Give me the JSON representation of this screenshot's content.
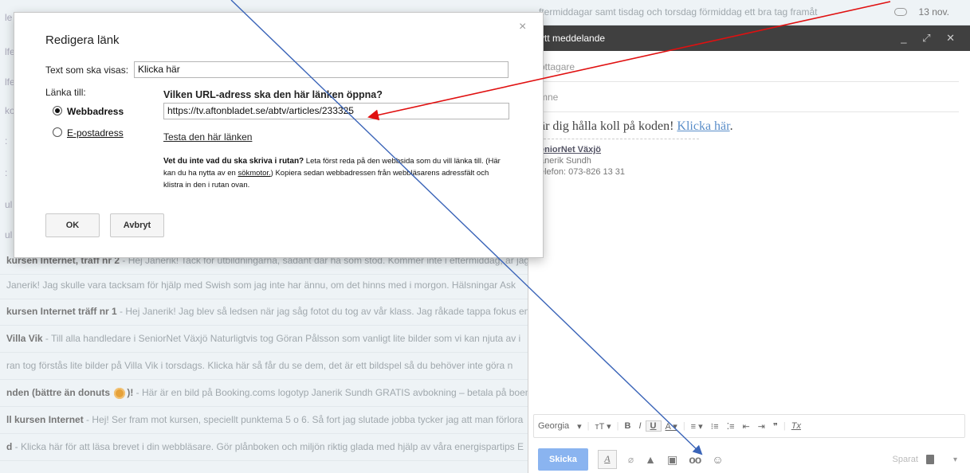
{
  "inbox": {
    "sidebar_fragments": [
      "le",
      "lfe",
      "lfe",
      "ko",
      ":",
      ":",
      "ul",
      "ul",
      ":"
    ],
    "rows": [
      {
        "sender": "kursen Internet, träff nr 2",
        "snippet": " - Hej Janerik! Tack för utbildningarna, sådant där ha som stöd. Kommer inte i eftermiddag, är jag"
      },
      {
        "sender": "",
        "snippet": "Janerik! Jag skulle vara tacksam för hjälp med Swish som jag inte har ännu, om det hinns med i morgon. Hälsningar Ask"
      },
      {
        "sender": "kursen Internet träff nr 1",
        "snippet": " - Hej Janerik! Jag blev så ledsen när jag såg fotot du tog av vår klass. Jag råkade tappa fokus en"
      },
      {
        "sender": "Villa Vik",
        "snippet": " - Till alla handledare i SeniorNet Växjö Naturligtvis tog Göran Pålsson som vanligt lite bilder som vi kan njuta av i"
      },
      {
        "sender": "",
        "snippet": "ran tog förstås lite bilder på Villa Vik i torsdags. Klicka här så får du se dem, det är ett bildspel så du behöver inte göra n"
      },
      {
        "sender": "nden (bättre än donuts ",
        "sender_tail": ")!",
        "snippet": " - Här är en bild på Booking.coms logotyp Janerik Sundh GRATIS avbokning – betala på boen"
      },
      {
        "sender": "ll kursen Internet",
        "snippet": " - Hej! Ser fram mot kursen, speciellt punktema 5 o 6. Så fort jag slutade jobba tycker jag att man förlora"
      },
      {
        "sender": "d",
        "snippet": " - Klicka här för att läsa brevet i din webbläsare. Gör plånboken och miljön riktig glada med hjälp av våra energispartips E"
      }
    ],
    "top_snippet": "ftermiddagar samt tisdag och torsdag förmiddag ett bra tag framåt",
    "top_date": "13 nov."
  },
  "compose": {
    "title": "ytt meddelande",
    "controls": "_ ⤢ ✕",
    "to_placeholder": "ottagare",
    "subject_placeholder": "mne",
    "body_text": "är dig hålla koll på koden! ",
    "body_link": "Klicka här",
    "body_end": ".",
    "signature": {
      "name": "eniorNet Växjö",
      "line2": "anerik Sundh",
      "line3": "elefon: 073-826 13 31"
    },
    "toolbar": {
      "font": "Georgia",
      "font_dd": "▾",
      "size": "тT ▾",
      "bold": "B",
      "italic": "I",
      "underline": "U",
      "color": "A ▾",
      "align": "≡ ▾",
      "numbered": "⁝≡",
      "bulleted": "⁚≡",
      "indent_less": "⇤",
      "indent_more": "⇥",
      "quote": "❞",
      "clear": "Tx"
    },
    "actions": {
      "send": "Skicka",
      "format": "A",
      "attach": "📎",
      "drive": "▲",
      "photo": "▣",
      "link": "oo",
      "emoji": "☺",
      "saved": "Sparat",
      "more": "▾"
    }
  },
  "dialog": {
    "title": "Redigera länk",
    "close": "×",
    "display_label": "Text som ska visas:",
    "display_value": "Klicka här",
    "link_to_label": "Länka till:",
    "radio_web": "Webbadress",
    "radio_email": "E-postadress",
    "url_question": "Vilken URL-adress ska den här länken öppna?",
    "url_value": "https://tv.aftonbladet.se/abtv/articles/233325",
    "test_link": "Testa den här länken",
    "help_bold": "Vet du inte vad du ska skriva i rutan?",
    "help_1": " Leta först reda på den webbsida som du vill länka till. (Här kan du ha nytta av en ",
    "help_link": "sökmotor.",
    "help_2": ") Kopiera sedan webbadressen från webbläsarens adressfält och klistra in den i rutan ovan.",
    "ok": "OK",
    "cancel": "Avbryt"
  },
  "colors": {
    "annotation_blue": "#3a64b8",
    "annotation_red": "#e01010",
    "send_button": "#8ab4f0",
    "compose_header": "#404040"
  }
}
